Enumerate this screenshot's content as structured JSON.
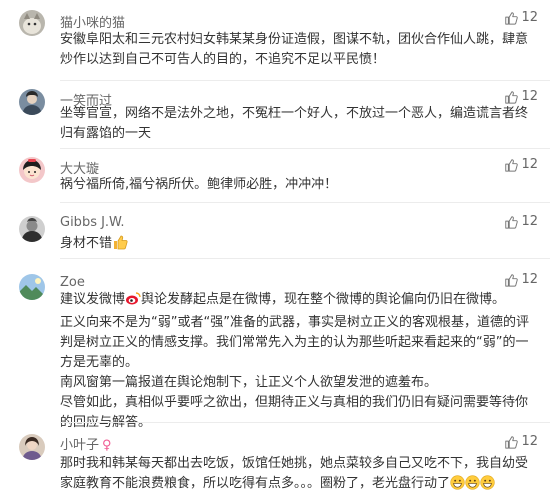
{
  "comments": [
    {
      "username": "猫小咪的猫",
      "likes": "12",
      "text": [
        "安徽阜阳太和三元农村妇女韩某某身份证造假，图谋不轨，团伙合作仙人跳，肆意炒作以达到自己不可告人的目的，不追究不足以平民愤！"
      ]
    },
    {
      "username": "一笑而过",
      "likes": "12",
      "text": [
        "坐等官宣，网络不是法外之地，不冤枉一个好人，不放过一个恶人，编造谎言者终归有露馅的一天"
      ]
    },
    {
      "username": "大大璇",
      "likes": "12",
      "text": [
        "祸兮福所倚,福兮祸所伏。鲍律师必胜，冲冲冲！"
      ]
    },
    {
      "username": "Gibbs J.W.",
      "likes": "12",
      "text": [
        "身材不错"
      ]
    },
    {
      "username": "Zoe",
      "likes": "12",
      "text": [
        "建议发微博",
        "舆论发酵起点是在微博，现在整个微博的舆论偏向仍旧在微博。",
        "正义向来不是为“弱”或者“强”准备的武器，事实是树立正义的客观根基，道德的评判是树立正义的情感支撑。我们常常先入为主的认为那些听起来看起来的“弱”的一方是无辜的。",
        "南风窗第一篇报道在舆论炮制下，让正义个人欲望发泄的遮羞布。",
        "尽管如此，真相似乎要呼之欲出，但期待正义与真相的我们仍旧有疑问需要等待你的回应与解答。"
      ]
    },
    {
      "username": "小叶子",
      "likes": "12",
      "text": [
        "那时我和韩某每天都出去吃饭，饭馆任她挑，她点菜较多自己又吃不下，我自幼受家庭教育不能浪费粮食，所以吃得有点多。。。圈粉了，老光盘行动了"
      ]
    }
  ],
  "icons": {
    "like": "thumbs-up-icon",
    "thumbs_emoji": "thumbs-up-emoji-icon",
    "weibo_emoji": "weibo-logo-icon",
    "grin_emoji": "grinning-face-emoji-icon",
    "female": "female-symbol-icon"
  },
  "colors": {
    "text": "#333333",
    "secondary": "#666666",
    "divider": "#ececec",
    "female": "#f05b93"
  }
}
